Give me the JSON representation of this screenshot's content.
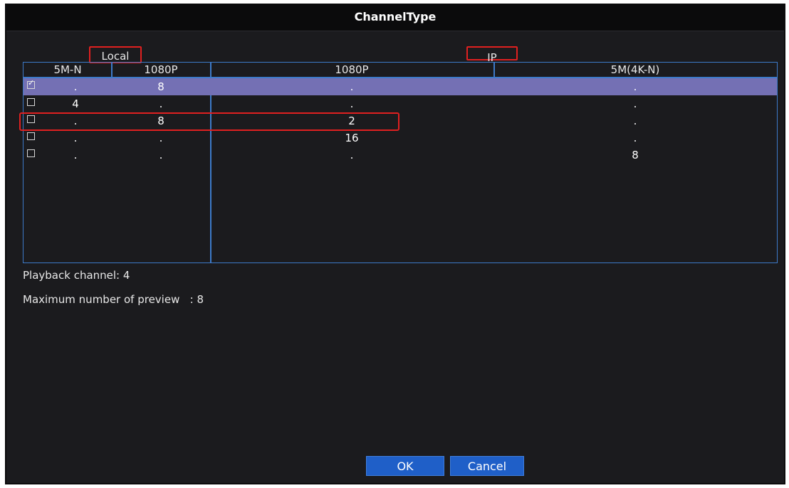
{
  "window": {
    "title": "ChannelType"
  },
  "groups": {
    "local": "Local",
    "ip": "IP"
  },
  "columns": [
    "5M-N",
    "1080P",
    "1080P",
    "5M(4K-N)"
  ],
  "rows": [
    {
      "checked": true,
      "cells": [
        ".",
        "8",
        ".",
        "."
      ]
    },
    {
      "checked": false,
      "cells": [
        "4",
        ".",
        ".",
        "."
      ]
    },
    {
      "checked": false,
      "cells": [
        ".",
        "8",
        "2",
        "."
      ]
    },
    {
      "checked": false,
      "cells": [
        ".",
        ".",
        "16",
        "."
      ]
    },
    {
      "checked": false,
      "cells": [
        ".",
        ".",
        ".",
        "8"
      ]
    }
  ],
  "info": {
    "playback": "Playback channel: 4",
    "preview": "Maximum number of preview   : 8"
  },
  "buttons": {
    "ok": "OK",
    "cancel": "Cancel"
  },
  "colors": {
    "accent": "#3d7ac9",
    "selected_row": "#7470b4",
    "highlight": "#e02020",
    "button": "#1f5fc8"
  }
}
